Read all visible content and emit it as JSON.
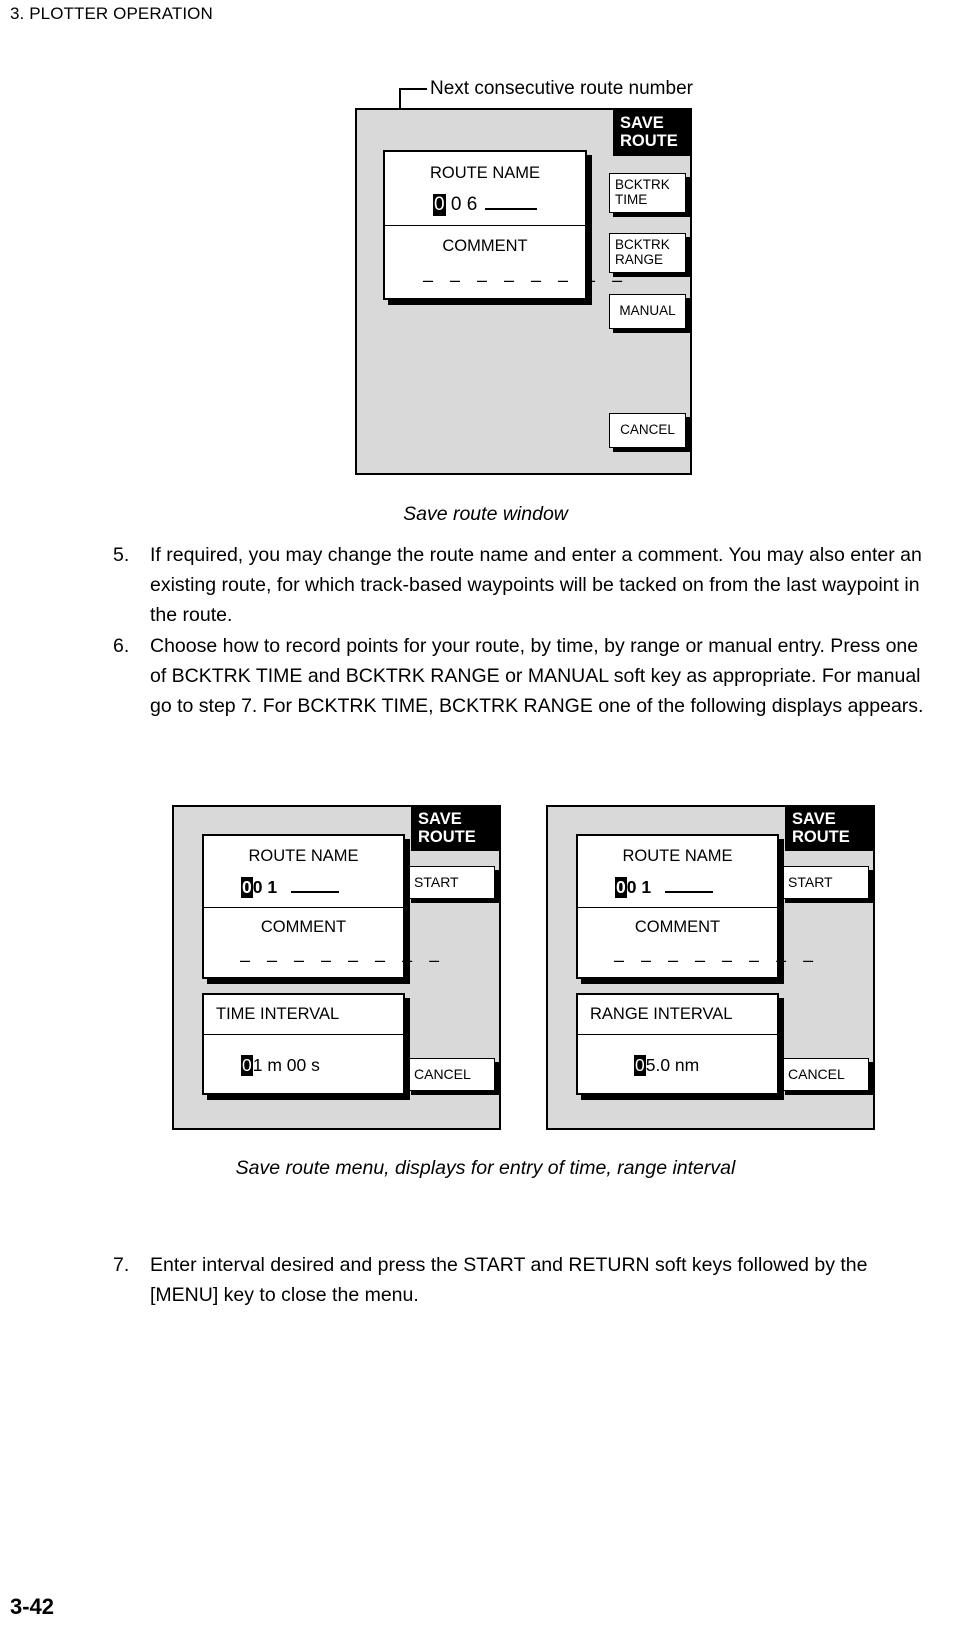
{
  "page": {
    "running_head": "3. PLOTTER OPERATION",
    "page_number": "3-42"
  },
  "callout": {
    "label": "Next consecutive route number"
  },
  "figure1": {
    "title_line1": "SAVE",
    "title_line2": "ROUTE",
    "route_name_label": "ROUTE NAME",
    "route_name_cursor": "0",
    "route_name_rest": " 0 6",
    "comment_label": "COMMENT",
    "comment_value": "– – – – – – – –",
    "softkeys": [
      {
        "line1": "BCKTRK",
        "line2": "TIME"
      },
      {
        "line1": "BCKTRK",
        "line2": "RANGE"
      },
      {
        "line1": "MANUAL",
        "line2": ""
      },
      {
        "line1": "CANCEL",
        "line2": ""
      }
    ],
    "caption": "Save route window"
  },
  "figure2_left": {
    "title_line1": "SAVE",
    "title_line2": "ROUTE",
    "route_name_label": "ROUTE NAME",
    "route_name_cursor": "0",
    "route_name_rest": "0 1",
    "comment_label": "COMMENT",
    "comment_value": "– – – – – – – –",
    "interval_label": "TIME INTERVAL",
    "interval_cursor": "0",
    "interval_rest": "1 m 00 s",
    "start_label": "START",
    "cancel_label": "CANCEL"
  },
  "figure2_right": {
    "title_line1": "SAVE",
    "title_line2": "ROUTE",
    "route_name_label": "ROUTE NAME",
    "route_name_cursor": "0",
    "route_name_rest": "0 1",
    "comment_label": "COMMENT",
    "comment_value": "– – – – – – – –",
    "interval_label": "RANGE INTERVAL",
    "interval_cursor": "0",
    "interval_rest": "5.0 nm",
    "start_label": "START",
    "cancel_label": "CANCEL"
  },
  "figure2": {
    "caption": "Save route menu, displays for entry of time, range interval"
  },
  "steps": [
    {
      "number": "5.",
      "text": "If required, you may change the route name and enter a comment. You may also enter an existing route, for which track-based waypoints will be tacked on from the last waypoint in the route."
    },
    {
      "number": "6.",
      "text": "Choose how to record points for your route, by time, by range or manual entry. Press one of BCKTRK TIME and BCKTRK RANGE or MANUAL soft key as appropriate. For manual go to step 7. For BCKTRK TIME, BCKTRK RANGE one of the following displays appears."
    }
  ],
  "step7": {
    "number": "7.",
    "text": "Enter interval desired and press the START and RETURN soft keys followed by the [MENU] key to close the menu."
  }
}
